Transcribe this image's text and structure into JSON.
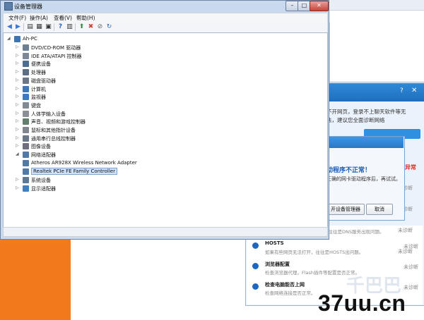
{
  "device_manager": {
    "title": "设备管理器",
    "menu": [
      "文件(F)",
      "操作(A)",
      "查看(V)",
      "帮助(H)"
    ],
    "tree": {
      "root": "Ah-PC",
      "items": [
        {
          "label": "DVD/CD-ROM 驱动器",
          "icon": "dvd-drive-icon",
          "color": "#6d7f93"
        },
        {
          "label": "IDE ATA/ATAPI 控制器",
          "icon": "ide-controller-icon",
          "color": "#7a8899"
        },
        {
          "label": "便携设备",
          "icon": "portable-device-icon",
          "color": "#4b6f95"
        },
        {
          "label": "处理器",
          "icon": "processor-icon",
          "color": "#5a6f84"
        },
        {
          "label": "磁盘驱动器",
          "icon": "disk-drive-icon",
          "color": "#6b7785"
        },
        {
          "label": "计算机",
          "icon": "computer-icon",
          "color": "#3f78b8"
        },
        {
          "label": "监视器",
          "icon": "monitor-icon",
          "color": "#3a7cc4"
        },
        {
          "label": "键盘",
          "icon": "keyboard-icon",
          "color": "#7f8a96"
        },
        {
          "label": "人体学输入设备",
          "icon": "hid-icon",
          "color": "#8a8f98"
        },
        {
          "label": "声音、视频和游戏控制器",
          "icon": "sound-icon",
          "color": "#5f7f6a"
        },
        {
          "label": "鼠标和其他指针设备",
          "icon": "mouse-icon",
          "color": "#80868f"
        },
        {
          "label": "通用串行总线控制器",
          "icon": "usb-icon",
          "color": "#6a7788"
        },
        {
          "label": "图像设备",
          "icon": "imaging-icon",
          "color": "#6f6f7f"
        },
        {
          "label": "网络适配器",
          "icon": "network-adapter-icon",
          "color": "#4f7aa8"
        }
      ],
      "network_children": [
        "Atheros AR928X Wireless Network Adapter",
        "Realtek PCIe FE Family Controller"
      ],
      "after_items": [
        {
          "label": "系统设备",
          "icon": "system-device-icon",
          "color": "#5b7896"
        },
        {
          "label": "显示适配器",
          "icon": "display-adapter-icon",
          "color": "#3f7fbf"
        }
      ]
    }
  },
  "diagnostics": {
    "intro": "不开网页，登录不上聊天软件等无法，建议您全面诊断网络",
    "items": [
      {
        "title": "HOSTS",
        "desc": "如果有些网页无法打开，往往是HOSTS出问题。",
        "status": "未诊断"
      },
      {
        "title": "浏览器配置",
        "desc": "检查浏览器代理，Flash插件等配置是否正常。",
        "status": "未诊断"
      },
      {
        "title": "检查电脑能否上网",
        "desc": "检查网络连接是否正常。",
        "status": "未诊断"
      }
    ],
    "side_statuses": [
      "未诊断",
      "未诊断",
      "未诊断",
      "未诊断"
    ],
    "partial_text": "，往往是DNS服务出现问题。"
  },
  "popup": {
    "heading": "动程序不正常！",
    "description": "正确的网卡驱动程序后，再试试。",
    "open_button": "开设备管理器",
    "cancel_button": "取消",
    "side_label": "异常"
  },
  "watermark": "37uu.cn"
}
